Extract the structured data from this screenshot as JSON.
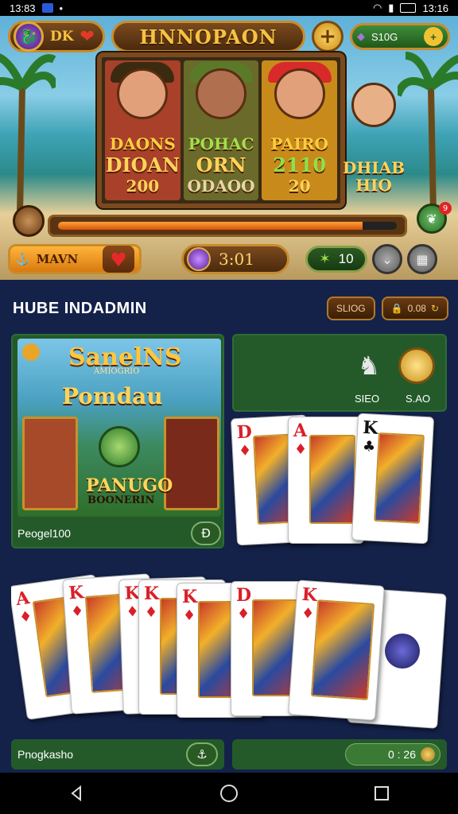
{
  "status_bar": {
    "time_left": "13:83",
    "time_right": "13:16"
  },
  "header": {
    "profile_label": "DK",
    "title": "HNNOPAON",
    "gem_value": "S10G"
  },
  "reels": [
    {
      "name": "DAONS",
      "value1": "DIOAN",
      "value2": "200",
      "bg": "#a8402a"
    },
    {
      "name": "POHAC",
      "value1": "ORN",
      "value2": "ODAOO",
      "bg": "#6a6a2a"
    },
    {
      "name": "PAIRO",
      "value1": "2110",
      "value2": "20",
      "bg": "#c88a1a"
    }
  ],
  "side_character": {
    "name_line1": "DHIAB",
    "name_line2": "HIO"
  },
  "notification_count": "9",
  "progress": {
    "fraction": 0.9
  },
  "controls": {
    "main_label": "MAVN",
    "timer": "3:01",
    "count": "10"
  },
  "hub": {
    "title": "HUBE INDADMIN",
    "chip1": "SLIOG",
    "chip2": "0.08",
    "panel1": {
      "title": "SanelNS",
      "subtitle": "AMIOGRIO",
      "heading": "Pomdau",
      "name": "PANUGO",
      "sub_name": "BOONERIN",
      "footer_label": "Peogel100"
    },
    "panel2": {
      "label1": "SIEO",
      "label2": "S.AO"
    },
    "footer1_label": "Pnogkasho",
    "footer2_timer": "0 : 26"
  },
  "cards_row1": [
    {
      "rank": "D",
      "suit": "♦",
      "color": "red"
    },
    {
      "rank": "A",
      "suit": "♦",
      "color": "red"
    },
    {
      "rank": "K",
      "suit": "♣",
      "color": "black"
    }
  ],
  "cards_row2": [
    {
      "rank": "A",
      "suit": "♦",
      "color": "red"
    },
    {
      "rank": "K",
      "suit": "♦",
      "color": "red"
    },
    {
      "rank": "K",
      "suit": "♦",
      "color": "red"
    },
    {
      "rank": "K",
      "suit": "♦",
      "color": "red"
    },
    {
      "rank": "K",
      "suit": "♦",
      "color": "red"
    },
    {
      "rank": "D",
      "suit": "♦",
      "color": "red"
    },
    {
      "rank": "K",
      "suit": "♦",
      "color": "red"
    }
  ],
  "colors": {
    "accent_gold": "#f7c240",
    "panel_green": "#245a2a",
    "hub_navy": "#14224a"
  },
  "icons": [
    "coin-icon",
    "plus-icon",
    "gem-icon",
    "heart-icon",
    "leaf-icon",
    "chevron-down-icon",
    "grid-icon",
    "back-icon",
    "home-icon",
    "recents-icon"
  ]
}
